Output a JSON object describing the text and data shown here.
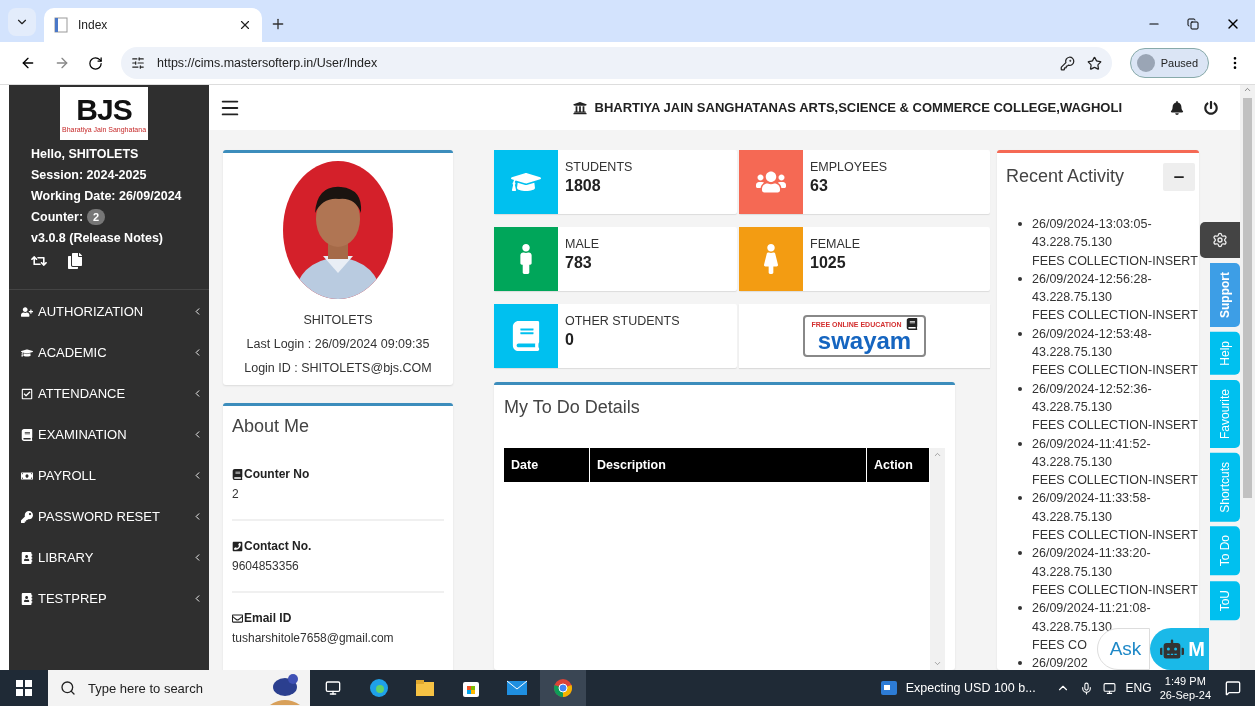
{
  "browser": {
    "tab_title": "Index",
    "url": "https://cims.mastersofterp.in/User/Index",
    "profile_status": "Paused"
  },
  "sidebar": {
    "logo": {
      "letters": "BJS",
      "caption": "Bharatiya Jain Sanghatana"
    },
    "greeting": "Hello, SHITOLETS",
    "session": "Session: 2024-2025",
    "working_date": "Working Date: 26/09/2024",
    "counter_label": "Counter:",
    "counter": "2",
    "version": "v3.0.8 (Release Notes)",
    "menu": [
      {
        "label": "AUTHORIZATION",
        "kind": "user"
      },
      {
        "label": "ACADEMIC",
        "kind": "academic"
      },
      {
        "label": "ATTENDANCE",
        "kind": "attendance"
      },
      {
        "label": "EXAMINATION",
        "kind": "exam"
      },
      {
        "label": "PAYROLL",
        "kind": "payroll"
      },
      {
        "label": "PASSWORD RESET",
        "kind": "key"
      },
      {
        "label": "LIBRARY",
        "kind": "contact"
      },
      {
        "label": "TESTPREP",
        "kind": "contact"
      }
    ]
  },
  "header": {
    "college": "BHARTIYA JAIN SANGHATANAS ARTS,SCIENCE & COMMERCE COLLEGE,WAGHOLI"
  },
  "profile": {
    "name": "SHITOLETS",
    "last_login": "Last Login : 26/09/2024 09:09:35",
    "login_id": "Login ID : SHITOLETS@bjs.COM"
  },
  "about": {
    "title": "About Me",
    "fields": [
      {
        "kind": "counter",
        "label": "Counter No",
        "value": "2"
      },
      {
        "kind": "phone",
        "label": "Contact No.",
        "value": "9604853356"
      },
      {
        "kind": "email",
        "label": "Email ID",
        "value": "tusharshitole7658@gmail.com"
      }
    ]
  },
  "stats": [
    {
      "kind": "students",
      "label": "STUDENTS",
      "value": "1808",
      "color": "#00c0ef"
    },
    {
      "kind": "employees",
      "label": "EMPLOYEES",
      "value": "63",
      "color": "#f56954"
    },
    {
      "kind": "male",
      "label": "MALE",
      "value": "783",
      "color": "#00a65a"
    },
    {
      "kind": "female",
      "label": "FEMALE",
      "value": "1025",
      "color": "#f39c12"
    },
    {
      "kind": "other",
      "label": "OTHER STUDENTS",
      "value": "0",
      "color": "#00c0ef"
    }
  ],
  "swayam": {
    "tagline": "FREE ONLINE EDUCATION",
    "name": "swayam"
  },
  "todo": {
    "title": "My To Do Details",
    "columns": [
      "Date",
      "Description",
      "Action"
    ]
  },
  "recent_activity": {
    "title": "Recent Activity",
    "items": [
      {
        "time": "26/09/2024-13:03:05-",
        "ip": "43.228.75.130",
        "action": "FEES COLLECTION-INSERT"
      },
      {
        "time": "26/09/2024-12:56:28-",
        "ip": "43.228.75.130",
        "action": "FEES COLLECTION-INSERT"
      },
      {
        "time": "26/09/2024-12:53:48-",
        "ip": "43.228.75.130",
        "action": "FEES COLLECTION-INSERT"
      },
      {
        "time": "26/09/2024-12:52:36-",
        "ip": "43.228.75.130",
        "action": "FEES COLLECTION-INSERT"
      },
      {
        "time": "26/09/2024-11:41:52-",
        "ip": "43.228.75.130",
        "action": "FEES COLLECTION-INSERT"
      },
      {
        "time": "26/09/2024-11:33:58-",
        "ip": "43.228.75.130",
        "action": "FEES COLLECTION-INSERT"
      },
      {
        "time": "26/09/2024-11:33:20-",
        "ip": "43.228.75.130",
        "action": "FEES COLLECTION-INSERT"
      },
      {
        "time": "26/09/2024-11:21:08-",
        "ip": "43.228.75.130",
        "action": "FEES CO"
      },
      {
        "time": "26/09/202"
      }
    ]
  },
  "side_tabs": [
    {
      "label": "Support",
      "selected": true
    },
    {
      "label": "Help",
      "selected": false
    },
    {
      "label": "Favourite",
      "selected": false
    },
    {
      "label": "Shortcuts",
      "selected": false
    },
    {
      "label": "To Do",
      "selected": false
    },
    {
      "label": "ToU",
      "selected": false
    }
  ],
  "chat": {
    "ask": "Ask",
    "brand": "M"
  },
  "taskbar": {
    "search_placeholder": "Type here to search",
    "news": "Expecting USD 100 b...",
    "language": "ENG",
    "time": "1:49 PM",
    "date": "26-Sep-24"
  }
}
